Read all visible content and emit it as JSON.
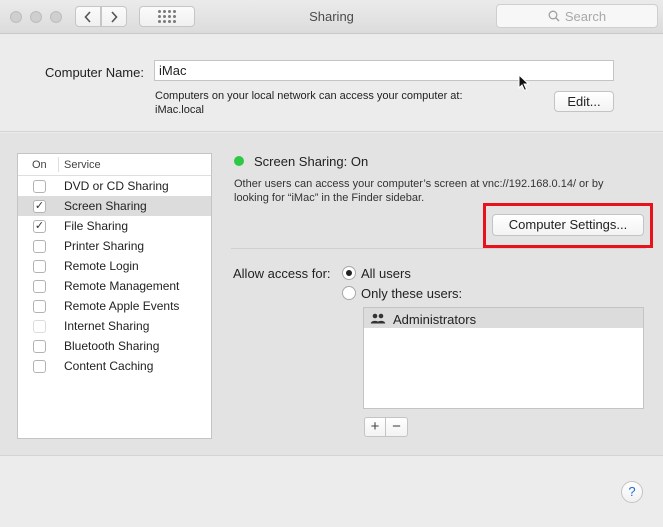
{
  "window": {
    "title": "Sharing"
  },
  "toolbar": {
    "back_icon": "chevron-left-icon",
    "forward_icon": "chevron-right-icon",
    "grid_icon": "grid-icon",
    "search_placeholder": "Search"
  },
  "computer_name": {
    "label": "Computer Name:",
    "value": "iMac",
    "info_line1": "Computers on your local network can access your computer at:",
    "info_line2": "iMac.local",
    "edit_label": "Edit..."
  },
  "services": {
    "header_on": "On",
    "header_service": "Service",
    "items": [
      {
        "label": "DVD or CD Sharing",
        "checked": false,
        "selected": false
      },
      {
        "label": "Screen Sharing",
        "checked": true,
        "selected": true
      },
      {
        "label": "File Sharing",
        "checked": true,
        "selected": false
      },
      {
        "label": "Printer Sharing",
        "checked": false,
        "selected": false
      },
      {
        "label": "Remote Login",
        "checked": false,
        "selected": false
      },
      {
        "label": "Remote Management",
        "checked": false,
        "selected": false
      },
      {
        "label": "Remote Apple Events",
        "checked": false,
        "selected": false
      },
      {
        "label": "Internet Sharing",
        "checked": false,
        "selected": false,
        "disabled": true
      },
      {
        "label": "Bluetooth Sharing",
        "checked": false,
        "selected": false
      },
      {
        "label": "Content Caching",
        "checked": false,
        "selected": false
      }
    ]
  },
  "detail": {
    "status": "Screen Sharing: On",
    "status_color": "#2ec944",
    "info_line1": "Other users can access your computer’s screen at vnc://192.168.0.14/ or by",
    "info_line2": "looking for “iMac” in the Finder sidebar.",
    "computer_settings_label": "Computer Settings...",
    "highlight_color": "#e8111c",
    "access_label": "Allow access for:",
    "option_all": "All users",
    "option_only": "Only these users:",
    "selected_option": "all",
    "users": [
      "Administrators"
    ],
    "add_label": "+",
    "remove_label": "−"
  },
  "help": {
    "label": "?"
  }
}
